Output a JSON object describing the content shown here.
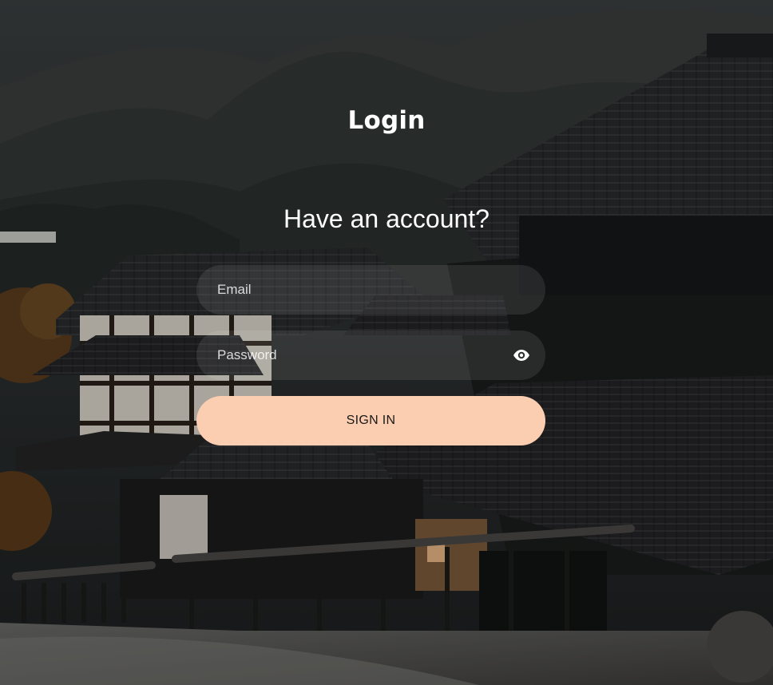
{
  "login": {
    "title": "Login",
    "subtitle": "Have an account?",
    "email": {
      "placeholder": "Email",
      "value": ""
    },
    "password": {
      "placeholder": "Password",
      "value": ""
    },
    "signin_label": "SIGN IN",
    "show_password_icon": "eye-icon"
  },
  "colors": {
    "button_bg": "#fbceb1",
    "button_text": "#1a1a1a",
    "text": "#ffffff",
    "field_bg": "rgba(255,255,255,0.09)"
  }
}
